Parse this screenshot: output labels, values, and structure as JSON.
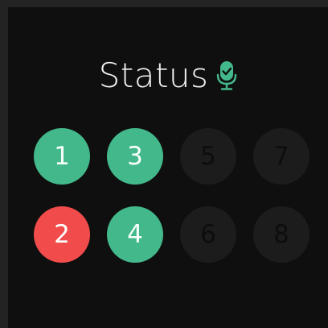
{
  "header": {
    "title": "Status",
    "icon": "microphone-check-icon",
    "icon_color": "#43b98b"
  },
  "colors": {
    "active": "#43b98b",
    "error": "#f14b4b",
    "inactive": "#1c1c1c"
  },
  "channels": {
    "c1": {
      "label": "1",
      "state": "active"
    },
    "c2": {
      "label": "2",
      "state": "error"
    },
    "c3": {
      "label": "3",
      "state": "active"
    },
    "c4": {
      "label": "4",
      "state": "active"
    },
    "c5": {
      "label": "5",
      "state": "inactive"
    },
    "c6": {
      "label": "6",
      "state": "inactive"
    },
    "c7": {
      "label": "7",
      "state": "inactive"
    },
    "c8": {
      "label": "8",
      "state": "inactive"
    }
  }
}
